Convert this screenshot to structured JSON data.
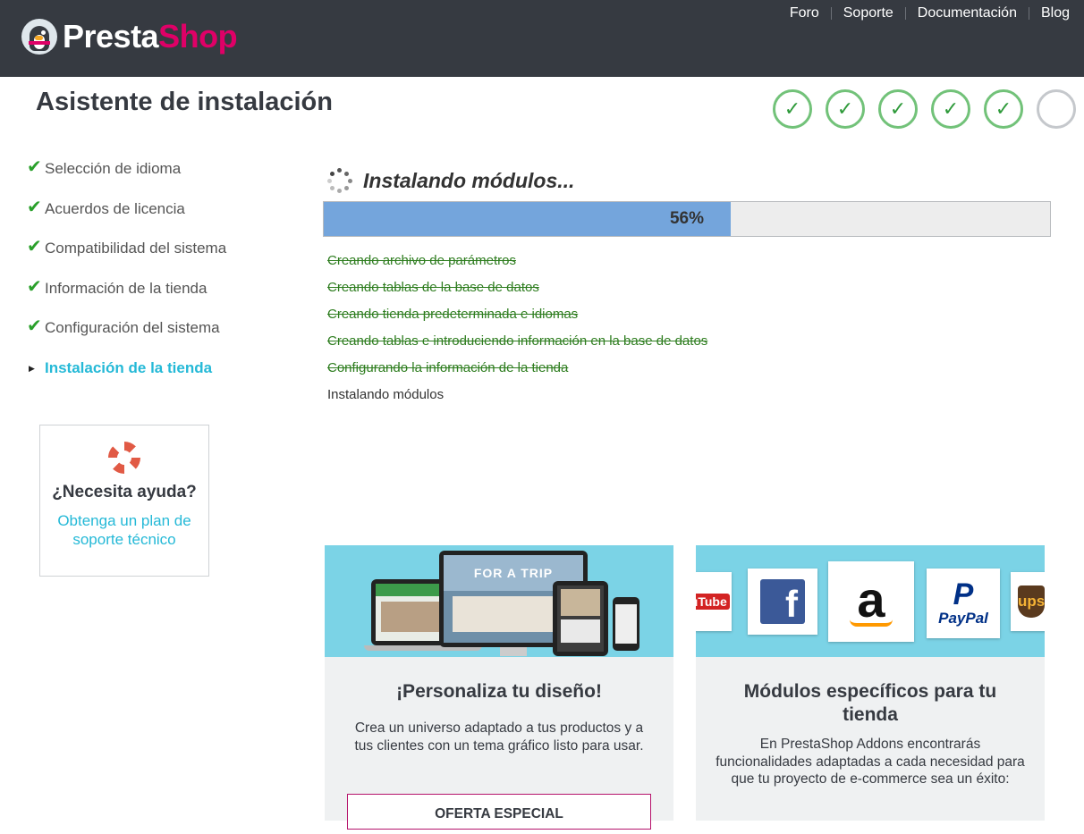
{
  "header": {
    "logo": {
      "part1": "Presta",
      "part2": "Shop"
    },
    "nav": [
      {
        "label": "Foro"
      },
      {
        "label": "Soporte"
      },
      {
        "label": "Documentación"
      },
      {
        "label": "Blog"
      }
    ]
  },
  "page_title": "Asistente de instalación",
  "progress_steps": {
    "completed": 5,
    "total": 6,
    "check_glyph": "✓"
  },
  "sidebar": {
    "steps": [
      {
        "label": "Selección de idioma",
        "status": "done"
      },
      {
        "label": "Acuerdos de licencia",
        "status": "done"
      },
      {
        "label": "Compatibilidad del sistema",
        "status": "done"
      },
      {
        "label": "Información de la tienda",
        "status": "done"
      },
      {
        "label": "Configuración del sistema",
        "status": "done"
      },
      {
        "label": "Instalación de la tienda",
        "status": "current"
      }
    ],
    "help": {
      "title": "¿Necesita ayuda?",
      "link": "Obtenga un plan de soporte técnico"
    }
  },
  "install": {
    "title": "Instalando módulos...",
    "progress_percent": 56,
    "progress_label": "56%",
    "tasks": [
      {
        "label": "Creando archivo de parámetros",
        "done": true
      },
      {
        "label": "Creando tablas de la base de datos",
        "done": true
      },
      {
        "label": "Creando tienda predeterminada e idiomas",
        "done": true
      },
      {
        "label": "Creando tablas e introduciendo información en la base de datos",
        "done": true
      },
      {
        "label": "Configurando la información de la tienda",
        "done": true
      },
      {
        "label": "Instalando módulos",
        "done": false
      }
    ]
  },
  "cards": [
    {
      "title": "¡Personaliza tu diseño!",
      "description": "Crea un universo adaptado a tus productos y a tus clientes con un tema gráfico listo para usar.",
      "button": "OFERTA ESPECIAL",
      "banner_text": "FOR A TRIP"
    },
    {
      "title": "Módulos específicos para tu tienda",
      "description": "En PrestaShop Addons encontrarás funcionalidades adaptadas a cada necesidad para que tu proyecto de e-commerce sea un éxito:",
      "logos": [
        "ouTube",
        "f",
        "a",
        "PayPal",
        "ups"
      ]
    }
  ],
  "colors": {
    "header_bg": "#363a41",
    "brand_pink": "#df0067",
    "accent_cyan": "#25b9d7",
    "check_green": "#2aa02b",
    "progress_fill": "#74a5dc",
    "banner_bg": "#7bd3e6"
  }
}
